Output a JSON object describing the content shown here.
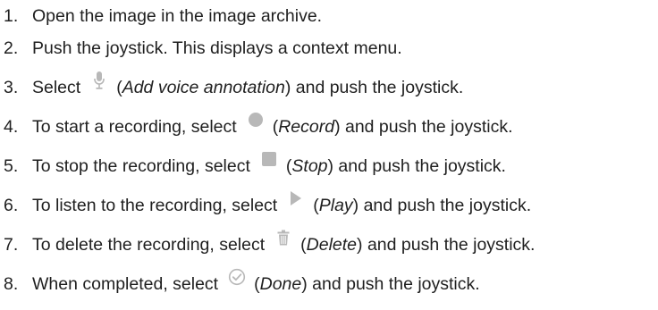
{
  "instructions": {
    "steps": [
      {
        "number": "1.",
        "text": "Open the image in the image archive."
      },
      {
        "number": "2.",
        "text": "Push the joystick. This displays a context menu."
      },
      {
        "number": "3.",
        "pre": "Select",
        "icon": "microphone-icon",
        "paren_open": "(",
        "action": "Add voice annotation",
        "post": ") and push the joystick."
      },
      {
        "number": "4.",
        "pre": "To start a recording, select",
        "icon": "record-icon",
        "paren_open": "(",
        "action": "Record",
        "post": ") and push the joystick."
      },
      {
        "number": "5.",
        "pre": "To stop the recording, select",
        "icon": "stop-icon",
        "paren_open": "(",
        "action": "Stop",
        "post": ") and push the joystick."
      },
      {
        "number": "6.",
        "pre": "To listen to the recording, select",
        "icon": "play-icon",
        "paren_open": "(",
        "action": "Play",
        "post": ") and push the joystick."
      },
      {
        "number": "7.",
        "pre": "To delete the recording, select",
        "icon": "trash-icon",
        "paren_open": "(",
        "action": "Delete",
        "post": ") and push the joystick."
      },
      {
        "number": "8.",
        "pre": "When completed, select",
        "icon": "check-circle-icon",
        "paren_open": "(",
        "action": "Done",
        "post": ") and push the joystick."
      }
    ]
  },
  "colors": {
    "text": "#1f1f1f",
    "icon": "#b8b8b8"
  }
}
